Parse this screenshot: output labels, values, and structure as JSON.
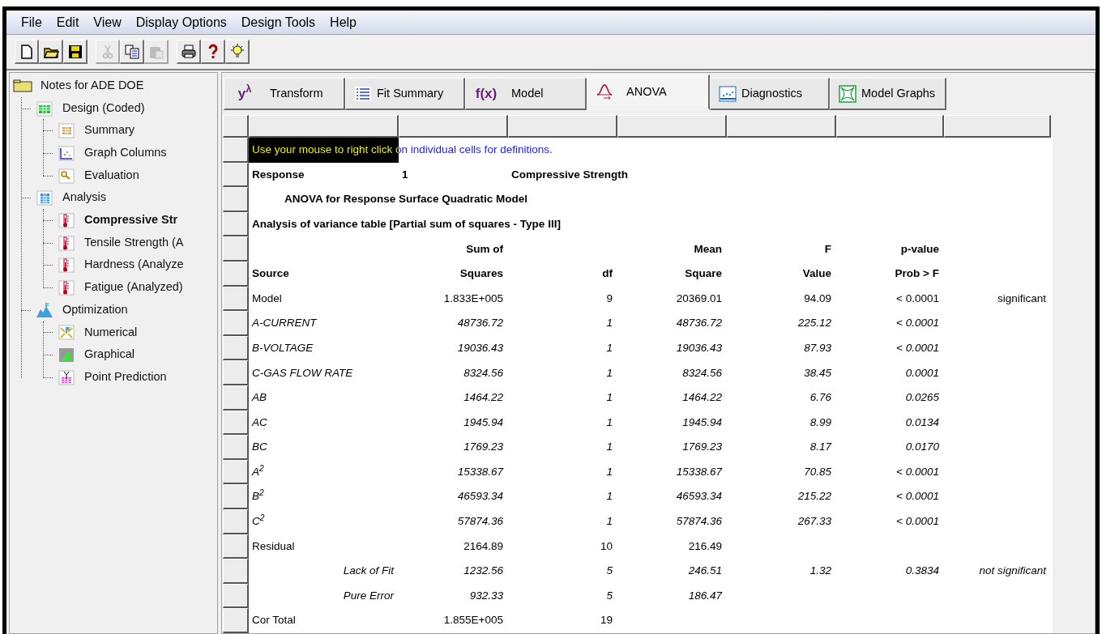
{
  "menu": [
    "File",
    "Edit",
    "View",
    "Display Options",
    "Design Tools",
    "Help"
  ],
  "toolbar": [
    [
      {
        "kind": "new",
        "disabled": false
      },
      {
        "kind": "open",
        "disabled": false
      },
      {
        "kind": "save",
        "disabled": false
      }
    ],
    [
      {
        "kind": "cut",
        "disabled": true
      },
      {
        "kind": "copy",
        "disabled": false
      },
      {
        "kind": "paste",
        "disabled": true
      }
    ],
    [
      {
        "kind": "print",
        "disabled": false
      },
      {
        "kind": "help",
        "disabled": false
      },
      {
        "kind": "tip",
        "disabled": false
      }
    ]
  ],
  "tree": {
    "label": "Notes for ADE DOE",
    "kind": "folder",
    "selected": false,
    "children": [
      {
        "label": "Design (Coded)",
        "kind": "sheet",
        "selected": false,
        "children": [
          {
            "label": "Summary",
            "kind": "table",
            "selected": false
          },
          {
            "label": "Graph Columns",
            "kind": "graph",
            "selected": false
          },
          {
            "label": "Evaluation",
            "kind": "magnifier",
            "selected": false
          }
        ]
      },
      {
        "label": "Analysis",
        "kind": "calculator",
        "selected": false,
        "children": [
          {
            "label": "Compressive Str",
            "kind": "thermometer",
            "selected": true
          },
          {
            "label": "Tensile Strength (A",
            "kind": "thermometer",
            "selected": false
          },
          {
            "label": "Hardness (Analyze",
            "kind": "thermometer",
            "selected": false
          },
          {
            "label": "Fatigue (Analyzed)",
            "kind": "thermometer",
            "selected": false
          }
        ]
      },
      {
        "label": "Optimization",
        "kind": "mountain",
        "selected": false,
        "children": [
          {
            "label": "Numerical",
            "kind": "numerical",
            "selected": false
          },
          {
            "label": "Graphical",
            "kind": "graphical",
            "selected": false
          },
          {
            "label": "Point Prediction",
            "kind": "point",
            "selected": false
          }
        ]
      }
    ]
  },
  "tabs": [
    {
      "label": "Transform",
      "kind": "glyph",
      "glyph": "y$^{λ}$",
      "selected": false
    },
    {
      "label": "Fit Summary",
      "kind": "list",
      "selected": false
    },
    {
      "label": "Model",
      "kind": "glyph",
      "glyph": "f(x)",
      "selected": false
    },
    {
      "label": "ANOVA",
      "kind": "bell",
      "selected": true
    },
    {
      "label": "Diagnostics",
      "kind": "scatter",
      "selected": false
    },
    {
      "label": "Model Graphs",
      "kind": "surface",
      "selected": false
    }
  ],
  "report": {
    "hint": {
      "text": "Use your mouse to right click on individual cells for definitions.",
      "highlighted": true
    },
    "response": {
      "label": "Response",
      "number": "1",
      "name": "Compressive Strength"
    },
    "title": "ANOVA for Response Surface Quadratic Model",
    "subtitle": "Analysis of variance table [Partial sum of squares - Type III]",
    "header": [
      {
        "ss": "Sum of",
        "ms": "Mean",
        "f": "F",
        "p": "p-value"
      },
      {
        "source": "Source",
        "ss": "Squares",
        "df": "df",
        "ms": "Square",
        "f": "Value",
        "p": "Prob > F"
      }
    ],
    "rows": [
      {
        "kind": "main",
        "italic": false,
        "source": "Model",
        "ss": "1.833E+005",
        "df": "9",
        "ms": "20369.01",
        "f": "94.09",
        "p": "< 0.0001",
        "note": "significant"
      },
      {
        "kind": "main",
        "italic": true,
        "source": "A-CURRENT",
        "ss": "48736.72",
        "df": "1",
        "ms": "48736.72",
        "f": "225.12",
        "p": "< 0.0001"
      },
      {
        "kind": "main",
        "italic": true,
        "source": "B-VOLTAGE",
        "ss": "19036.43",
        "df": "1",
        "ms": "19036.43",
        "f": "87.93",
        "p": "< 0.0001"
      },
      {
        "kind": "main",
        "italic": true,
        "source": "C-GAS FLOW RATE",
        "ss": "8324.56",
        "df": "1",
        "ms": "8324.56",
        "f": "38.45",
        "p": "0.0001"
      },
      {
        "kind": "main",
        "italic": true,
        "source": "AB",
        "ss": "1464.22",
        "df": "1",
        "ms": "1464.22",
        "f": "6.76",
        "p": "0.0265"
      },
      {
        "kind": "main",
        "italic": true,
        "source": "AC",
        "ss": "1945.94",
        "df": "1",
        "ms": "1945.94",
        "f": "8.99",
        "p": "0.0134"
      },
      {
        "kind": "main",
        "italic": true,
        "source": "BC",
        "ss": "1769.23",
        "df": "1",
        "ms": "1769.23",
        "f": "8.17",
        "p": "0.0170"
      },
      {
        "kind": "main",
        "italic": true,
        "source": "A$^{2}$",
        "ss": "15338.67",
        "df": "1",
        "ms": "15338.67",
        "f": "70.85",
        "p": "< 0.0001"
      },
      {
        "kind": "main",
        "italic": true,
        "source": "B$^{2}$",
        "ss": "46593.34",
        "df": "1",
        "ms": "46593.34",
        "f": "215.22",
        "p": "< 0.0001"
      },
      {
        "kind": "main",
        "italic": true,
        "source": "C$^{2}$",
        "ss": "57874.36",
        "df": "1",
        "ms": "57874.36",
        "f": "267.33",
        "p": "< 0.0001"
      },
      {
        "kind": "main",
        "italic": false,
        "source": "Residual",
        "ss": "2164.89",
        "df": "10",
        "ms": "216.49"
      },
      {
        "kind": "sub",
        "italic": true,
        "source": "Lack of Fit",
        "ss": "1232.56",
        "df": "5",
        "ms": "246.51",
        "f": "1.32",
        "p": "0.3834",
        "note": "not significant"
      },
      {
        "kind": "sub",
        "italic": true,
        "source": "Pure Error",
        "ss": "932.33",
        "df": "5",
        "ms": "186.47"
      },
      {
        "kind": "main",
        "italic": false,
        "source": "Cor Total",
        "ss": "1.855E+005",
        "df": "19"
      }
    ]
  }
}
